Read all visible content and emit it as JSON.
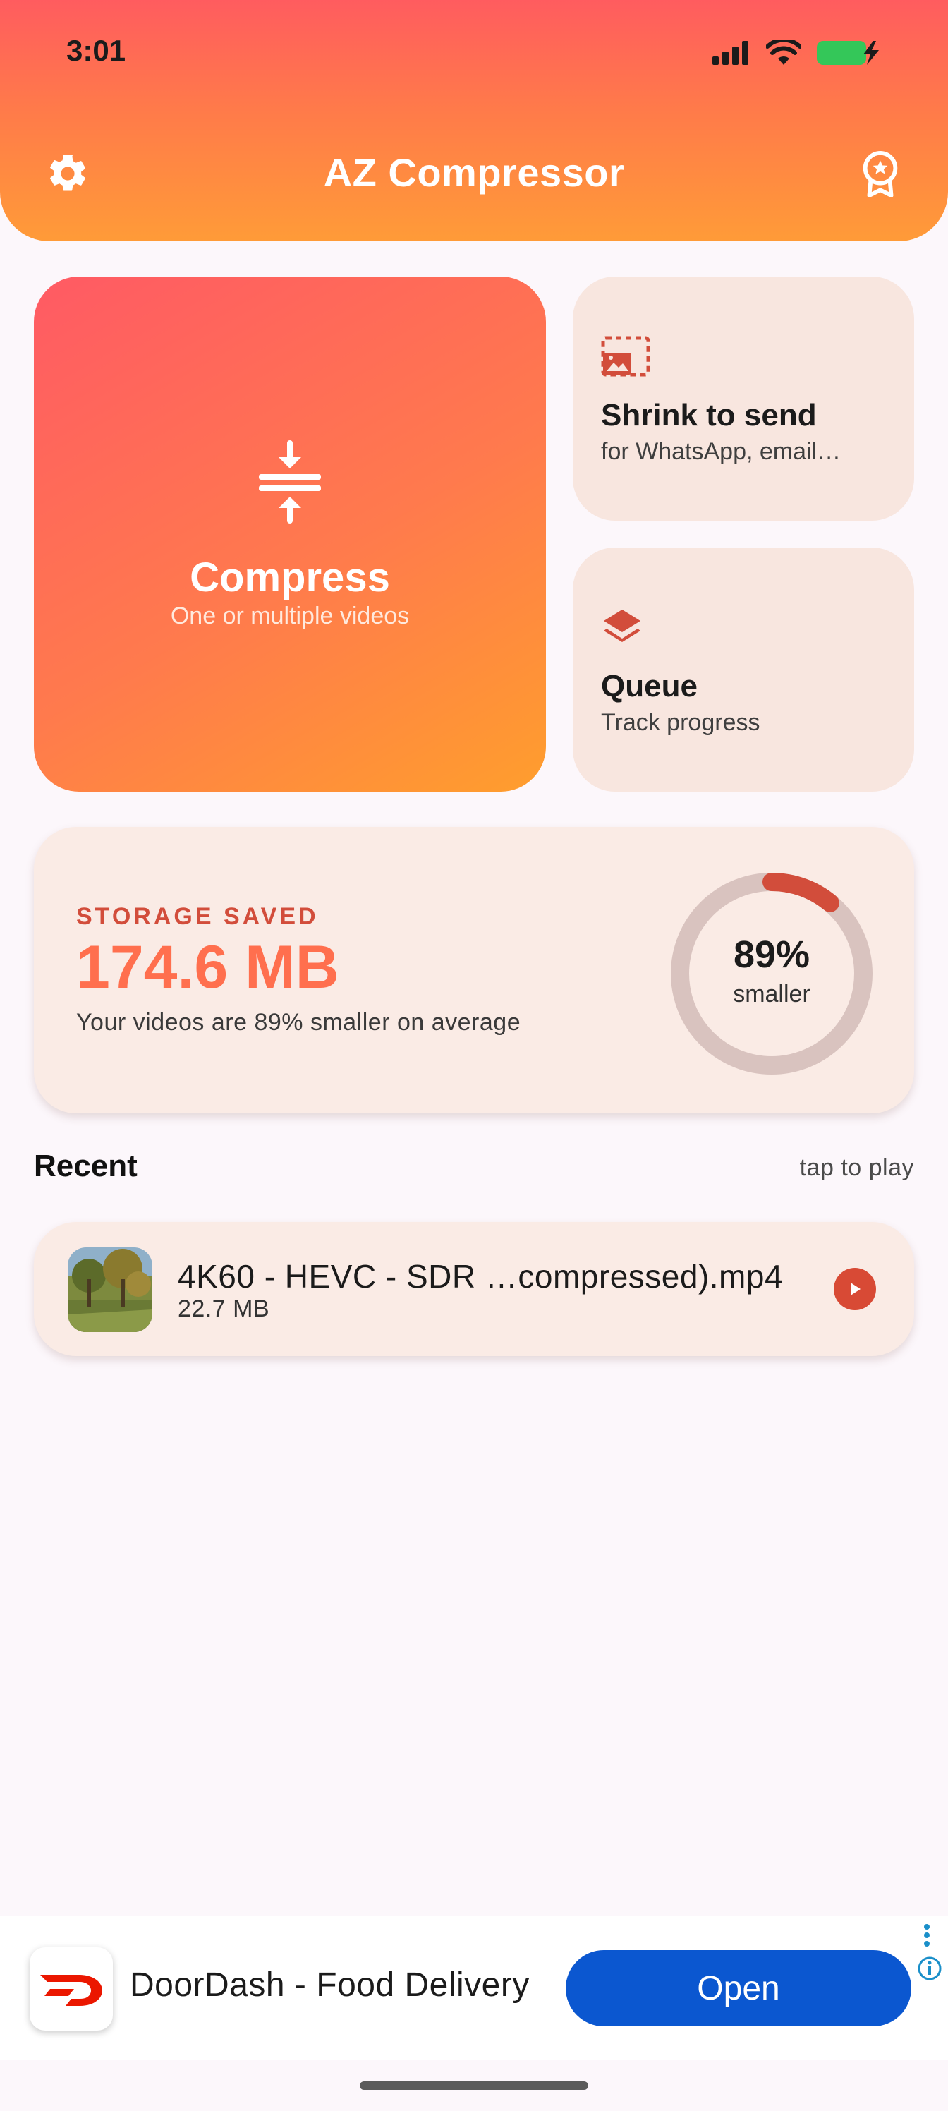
{
  "status_bar": {
    "time": "3:01"
  },
  "header": {
    "title": "AZ Compressor",
    "left_icon": "gear-icon",
    "right_icon": "award-badge-icon"
  },
  "actions": {
    "compress": {
      "title": "Compress",
      "subtitle": "One or multiple videos",
      "icon": "compress-arrows-icon"
    },
    "shrink": {
      "title": "Shrink to send",
      "subtitle": "for WhatsApp, email…",
      "icon": "resize-image-icon"
    },
    "queue": {
      "title": "Queue",
      "subtitle": "Track progress",
      "icon": "layers-icon"
    }
  },
  "storage": {
    "label": "STORAGE SAVED",
    "value": "174.6 MB",
    "description": "Your videos are 89% smaller on average",
    "ring_percent": "89%",
    "ring_label": "smaller",
    "ring_fraction": 0.11
  },
  "recent": {
    "title": "Recent",
    "hint": "tap to play",
    "items": [
      {
        "name": "4K60 - HEVC - SDR …compressed).mp4",
        "size": "22.7 MB"
      }
    ]
  },
  "ad": {
    "title": "DoorDash - Food Delivery",
    "button": "Open"
  },
  "colors": {
    "accent": "#ff6f4e",
    "accent_dark": "#d24d3b",
    "ad_button": "#0b57d0"
  }
}
